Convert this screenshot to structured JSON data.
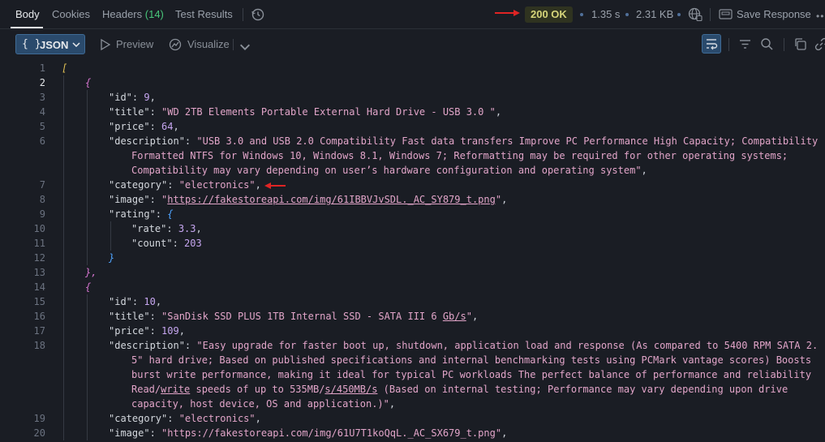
{
  "tabs": {
    "body": "Body",
    "cookies": "Cookies",
    "headers": "Headers",
    "headers_count": "(14)",
    "test_results": "Test Results"
  },
  "status": {
    "code": "200 OK",
    "time": "1.35 s",
    "size": "2.31 KB",
    "save": "Save Response",
    "badge_color": "#d6d57a"
  },
  "toolbar": {
    "format": "JSON",
    "braces": "{ }",
    "preview": "Preview",
    "visualize": "Visualize"
  },
  "gutter": [
    "1",
    "2",
    "3",
    "4",
    "5",
    "6",
    "",
    "",
    "7",
    "8",
    "9",
    "10",
    "11",
    "12",
    "13",
    "14",
    "15",
    "16",
    "17",
    "18",
    "",
    "",
    "",
    "",
    "19",
    "20"
  ],
  "code": {
    "l1_bracket": "[",
    "obj_open": "{",
    "obj_close": "},",
    "rating_open": "{",
    "rating_close": "}",
    "key_id": "\"id\"",
    "key_title": "\"title\"",
    "key_price": "\"price\"",
    "key_description": "\"description\"",
    "key_category": "\"category\"",
    "key_image": "\"image\"",
    "key_rating": "\"rating\"",
    "key_rate": "\"rate\"",
    "key_count": "\"count\"",
    "i1_id": "9",
    "i1_title": "\"WD 2TB Elements Portable External Hard Drive - USB 3.0 \"",
    "i1_price": "64",
    "i1_desc_1": "\"USB 3.0 and USB 2.0 Compatibility Fast data transfers Improve PC Performance High Capacity; Compatibility",
    "i1_desc_2": "Formatted NTFS for Windows 10, Windows 8.1, Windows 7; Reformatting may be required for other operating systems;",
    "i1_desc_3": "Compatibility may vary depending on user’s hardware configuration and operating system\"",
    "i1_category": "\"electronics\"",
    "i1_image_q": "\"",
    "i1_image_url": "https://fakestoreapi.com/img/61IBBVJvSDL._AC_SY879_t.png",
    "i1_rate": "3.3",
    "i1_count": "203",
    "i2_id": "10",
    "i2_title_a": "\"SanDisk SSD PLUS 1TB Internal SSD - SATA III 6 ",
    "i2_title_u": "Gb/s",
    "i2_title_b": "\"",
    "i2_price": "109",
    "i2_desc_1": "\"Easy upgrade for faster boot up, shutdown, application load and response (As compared to 5400 RPM SATA 2.",
    "i2_desc_2": "5\" hard drive; Based on published specifications and internal benchmarking tests using PCMark vantage scores) Boosts",
    "i2_desc_3": "burst write performance, making it ideal for typical PC workloads The perfect balance of performance and reliability",
    "i2_desc_4a": "Read/",
    "i2_desc_4u1": "write",
    "i2_desc_4b": " speeds of up to 535MB/",
    "i2_desc_4u2": "s/450MB/s",
    "i2_desc_4c": " (Based on internal testing; Performance may vary depending upon drive",
    "i2_desc_5": "capacity, host device, OS and application.)\"",
    "i2_category": "\"electronics\"",
    "i2_image": "\"https://fakestoreapi.com/img/61U7T1koQqL._AC_SX679_t.png\""
  },
  "colors": {
    "annotation_arrow": "#e02424",
    "accent_button": "#2a4a6c"
  }
}
